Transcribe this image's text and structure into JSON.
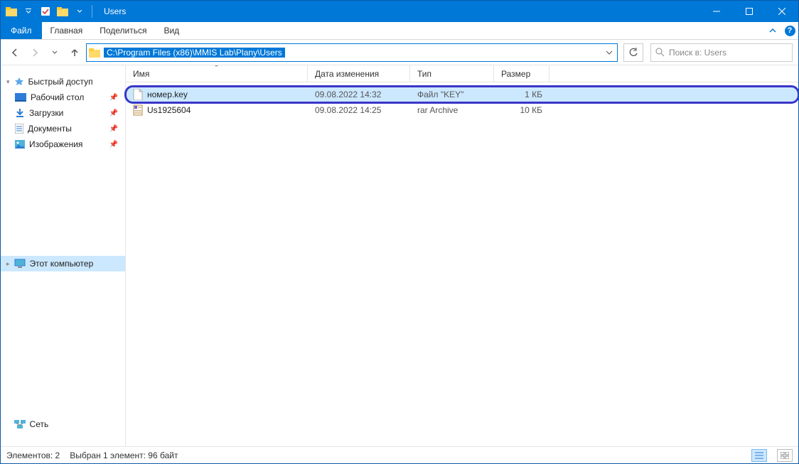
{
  "window": {
    "title": "Users"
  },
  "ribbon": {
    "file": "Файл",
    "tabs": [
      "Главная",
      "Поделиться",
      "Вид"
    ]
  },
  "address": {
    "path": "C:\\Program Files (x86)\\MMIS Lab\\Plany\\Users"
  },
  "search": {
    "placeholder": "Поиск в: Users"
  },
  "sidebar": {
    "quick_access": "Быстрый доступ",
    "items": [
      {
        "label": "Рабочий стол",
        "icon": "desktop",
        "pinned": true
      },
      {
        "label": "Загрузки",
        "icon": "downloads",
        "pinned": true
      },
      {
        "label": "Документы",
        "icon": "documents",
        "pinned": true
      },
      {
        "label": "Изображения",
        "icon": "pictures",
        "pinned": true
      }
    ],
    "this_pc": "Этот компьютер",
    "network": "Сеть"
  },
  "columns": {
    "name": "Имя",
    "date": "Дата изменения",
    "type": "Тип",
    "size": "Размер"
  },
  "files": [
    {
      "name": "номер.key",
      "date": "09.08.2022 14:32",
      "type": "Файл \"KEY\"",
      "size": "1 КБ",
      "selected": true,
      "highlighted": true,
      "icon": "file"
    },
    {
      "name": "Us1925604",
      "date": "09.08.2022 14:25",
      "type": "rar Archive",
      "size": "10 КБ",
      "selected": false,
      "highlighted": false,
      "icon": "rar"
    }
  ],
  "status": {
    "count": "Элементов: 2",
    "selection": "Выбран 1 элемент: 96 байт"
  }
}
